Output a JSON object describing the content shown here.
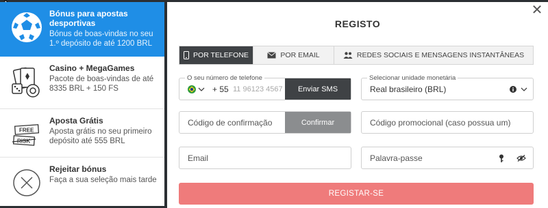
{
  "bonuses": [
    {
      "icon": "soccer-ball-icon",
      "title": "Bónus para apostas desportivas",
      "desc": "Bónus de boas-vindas no seu 1.º depósito de até 1200 BRL",
      "active": true
    },
    {
      "icon": "casino-cards-dice-icon",
      "title": "Casino + MegaGames",
      "desc": "Pacote de boas-vindas de até 8335 BRL + 150 FS",
      "active": false
    },
    {
      "icon": "free-risk-bet-icon",
      "title": "Aposta Grátis",
      "desc": "Aposta grátis no seu primeiro depósito até 555 BRL",
      "active": false
    },
    {
      "icon": "reject-x-icon",
      "title": "Rejeitar bónus",
      "desc": "Faça a sua seleção mais tarde",
      "active": false
    }
  ],
  "free_risk": {
    "free": "FREE",
    "risk": "RISK"
  },
  "modal": {
    "title": "REGISTO",
    "close_label": "✕",
    "tabs": [
      {
        "label": "POR TELEFONE",
        "icon": "phone-icon",
        "active": true
      },
      {
        "label": "POR EMAIL",
        "icon": "envelope-icon",
        "active": false
      },
      {
        "label": "REDES SOCIAIS E MENSAGENS INSTANTÂNEAS",
        "icon": "people-icon",
        "active": false
      }
    ],
    "phone": {
      "label": "O seu número de telefone",
      "country_code": "+ 55",
      "placeholder": "11 96123 4567",
      "send_sms": "Enviar SMS"
    },
    "currency": {
      "label": "Selecionar unidade monetária",
      "value": "Real brasileiro (BRL)"
    },
    "confirmation": {
      "placeholder": "Código de confirmação",
      "confirm": "Confirmar"
    },
    "promo": {
      "placeholder": "Código promocional (caso possua um)"
    },
    "email": {
      "placeholder": "Email"
    },
    "password": {
      "placeholder": "Palavra-passe"
    },
    "submit": "REGISTAR-SE"
  },
  "colors": {
    "accent": "#1f8ee6",
    "dark": "#3f4245",
    "submit": "#ef7b7b"
  }
}
